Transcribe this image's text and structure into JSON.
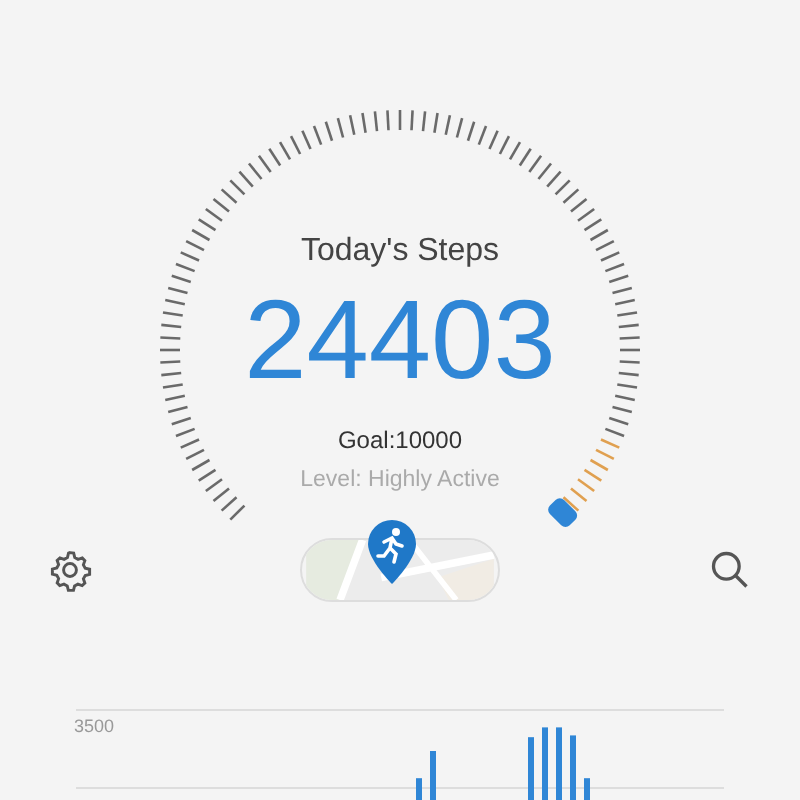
{
  "gauge": {
    "title": "Today's Steps",
    "steps": "24403",
    "goal": "Goal:10000",
    "level_text": "Level: Highly Active"
  },
  "activity_chart": {
    "axis_label": "3500"
  }
}
